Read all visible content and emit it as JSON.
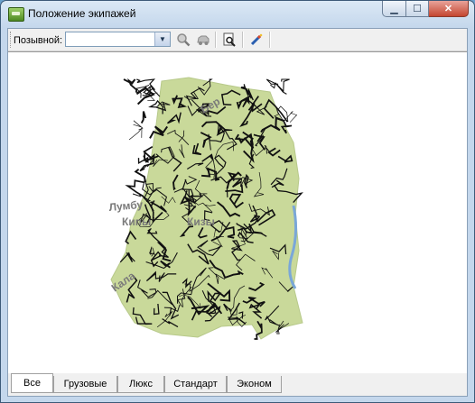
{
  "window": {
    "title": "Положение экипажей"
  },
  "caption_buttons": {
    "minimize": "▁",
    "maximize": "☐",
    "close": "✕"
  },
  "toolbar": {
    "callsign_label": "Позывной:",
    "callsign_value": "",
    "icons": [
      "search-zoom-icon",
      "locate-car-icon",
      "print-preview-icon",
      "wand-settings-icon"
    ]
  },
  "map": {
    "colors": {
      "forest": "#c9d99a",
      "roads": "#111111",
      "labels": "#7a7a7a",
      "water": "#7aa7d8"
    },
    "labels": [
      "Лумбу",
      "Кипы",
      "Кизы",
      "Бер",
      "Кала"
    ]
  },
  "tabs": [
    "Все",
    "Грузовые",
    "Люкс",
    "Стандарт",
    "Эконом"
  ],
  "active_tab": 0
}
